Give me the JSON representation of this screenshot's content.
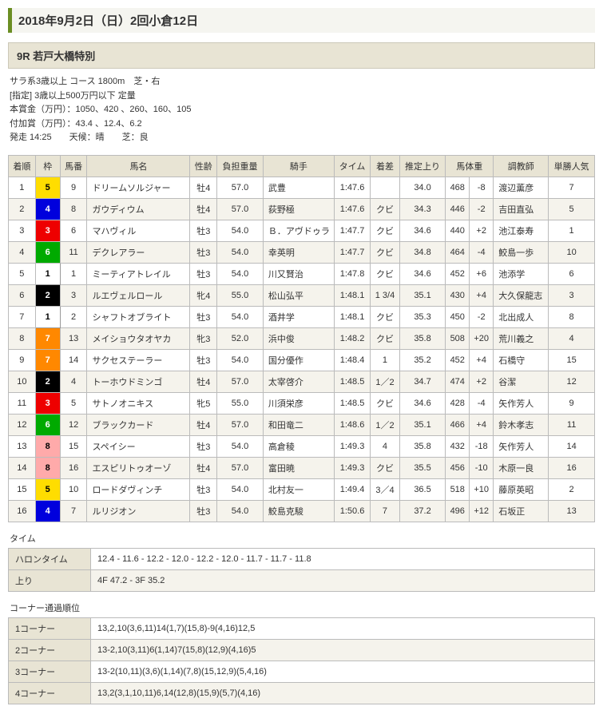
{
  "header": {
    "title": "2018年9月2日（日）2回小倉12日"
  },
  "race": {
    "title": "9R 若戸大橋特別",
    "line1": "サラ系3歳以上 コース 1800m　芝・右",
    "line2": "[指定] 3歳以上500万円以下 定量",
    "line3": "本賞金（万円）：1050、420 、260、160、105",
    "line4": "付加賞（万円）：43.4 、12.4、6.2",
    "line5": "発走 14:25　　天候：晴　　芝：良"
  },
  "columns": {
    "rank": "着順",
    "waku": "枠",
    "num": "馬番",
    "name": "馬名",
    "sex_age": "性齢",
    "weight": "負担重量",
    "jockey": "騎手",
    "time": "タイム",
    "margin": "着差",
    "agari": "推定上り",
    "bweight": "馬体重",
    "trainer": "調教師",
    "pop": "単勝人気"
  },
  "results": [
    {
      "rank": "1",
      "waku": 5,
      "num": "9",
      "name": "ドリームソルジャー",
      "sa": "牡4",
      "w": "57.0",
      "j": "武豊",
      "t": "1:47.6",
      "m": "",
      "a": "34.0",
      "bw": "468",
      "bd": "-8",
      "tr": "渡辺薫彦",
      "p": "7"
    },
    {
      "rank": "2",
      "waku": 4,
      "num": "8",
      "name": "ガウディウム",
      "sa": "牡4",
      "w": "57.0",
      "j": "荻野極",
      "t": "1:47.6",
      "m": "クビ",
      "a": "34.3",
      "bw": "446",
      "bd": "-2",
      "tr": "吉田直弘",
      "p": "5"
    },
    {
      "rank": "3",
      "waku": 3,
      "num": "6",
      "name": "マハヴィル",
      "sa": "牡3",
      "w": "54.0",
      "j": "Ｂ．アヴドゥラ",
      "t": "1:47.7",
      "m": "クビ",
      "a": "34.6",
      "bw": "440",
      "bd": "+2",
      "tr": "池江泰寿",
      "p": "1"
    },
    {
      "rank": "4",
      "waku": 6,
      "num": "11",
      "name": "デクレアラー",
      "sa": "牡3",
      "w": "54.0",
      "j": "幸英明",
      "t": "1:47.7",
      "m": "クビ",
      "a": "34.8",
      "bw": "464",
      "bd": "-4",
      "tr": "鮫島一歩",
      "p": "10"
    },
    {
      "rank": "5",
      "waku": 1,
      "num": "1",
      "name": "ミーティアトレイル",
      "sa": "牡3",
      "w": "54.0",
      "j": "川又賢治",
      "t": "1:47.8",
      "m": "クビ",
      "a": "34.6",
      "bw": "452",
      "bd": "+6",
      "tr": "池添学",
      "p": "6"
    },
    {
      "rank": "6",
      "waku": 2,
      "num": "3",
      "name": "ルエヴェルロール",
      "sa": "牝4",
      "w": "55.0",
      "j": "松山弘平",
      "t": "1:48.1",
      "m": "1 3/4",
      "a": "35.1",
      "bw": "430",
      "bd": "+4",
      "tr": "大久保龍志",
      "p": "3"
    },
    {
      "rank": "7",
      "waku": 1,
      "num": "2",
      "name": "シャフトオブライト",
      "sa": "牡3",
      "w": "54.0",
      "j": "酒井学",
      "t": "1:48.1",
      "m": "クビ",
      "a": "35.3",
      "bw": "450",
      "bd": "-2",
      "tr": "北出成人",
      "p": "8"
    },
    {
      "rank": "8",
      "waku": 7,
      "num": "13",
      "name": "メイショウタオヤカ",
      "sa": "牝3",
      "w": "52.0",
      "j": "浜中俊",
      "t": "1:48.2",
      "m": "クビ",
      "a": "35.8",
      "bw": "508",
      "bd": "+20",
      "tr": "荒川義之",
      "p": "4"
    },
    {
      "rank": "9",
      "waku": 7,
      "num": "14",
      "name": "サクセステーラー",
      "sa": "牡3",
      "w": "54.0",
      "j": "国分優作",
      "t": "1:48.4",
      "m": "1",
      "a": "35.2",
      "bw": "452",
      "bd": "+4",
      "tr": "石橋守",
      "p": "15"
    },
    {
      "rank": "10",
      "waku": 2,
      "num": "4",
      "name": "トーホウドミンゴ",
      "sa": "牡4",
      "w": "57.0",
      "j": "太宰啓介",
      "t": "1:48.5",
      "m": "1／2",
      "a": "34.7",
      "bw": "474",
      "bd": "+2",
      "tr": "谷潔",
      "p": "12"
    },
    {
      "rank": "11",
      "waku": 3,
      "num": "5",
      "name": "サトノオニキス",
      "sa": "牝5",
      "w": "55.0",
      "j": "川須栄彦",
      "t": "1:48.5",
      "m": "クビ",
      "a": "34.6",
      "bw": "428",
      "bd": "-4",
      "tr": "矢作芳人",
      "p": "9"
    },
    {
      "rank": "12",
      "waku": 6,
      "num": "12",
      "name": "ブラックカード",
      "sa": "牡4",
      "w": "57.0",
      "j": "和田竜二",
      "t": "1:48.6",
      "m": "1／2",
      "a": "35.1",
      "bw": "466",
      "bd": "+4",
      "tr": "鈴木孝志",
      "p": "11"
    },
    {
      "rank": "13",
      "waku": 8,
      "num": "15",
      "name": "スペイシー",
      "sa": "牡3",
      "w": "54.0",
      "j": "高倉稜",
      "t": "1:49.3",
      "m": "4",
      "a": "35.8",
      "bw": "432",
      "bd": "-18",
      "tr": "矢作芳人",
      "p": "14"
    },
    {
      "rank": "14",
      "waku": 8,
      "num": "16",
      "name": "エスピリトゥオーゾ",
      "sa": "牡4",
      "w": "57.0",
      "j": "富田暁",
      "t": "1:49.3",
      "m": "クビ",
      "a": "35.5",
      "bw": "456",
      "bd": "-10",
      "tr": "木原一良",
      "p": "16"
    },
    {
      "rank": "15",
      "waku": 5,
      "num": "10",
      "name": "ロードダヴィンチ",
      "sa": "牡3",
      "w": "54.0",
      "j": "北村友一",
      "t": "1:49.4",
      "m": "3／4",
      "a": "36.5",
      "bw": "518",
      "bd": "+10",
      "tr": "藤原英昭",
      "p": "2"
    },
    {
      "rank": "16",
      "waku": 4,
      "num": "7",
      "name": "ルリジオン",
      "sa": "牡3",
      "w": "54.0",
      "j": "鮫島克駿",
      "t": "1:50.6",
      "m": "7",
      "a": "37.2",
      "bw": "496",
      "bd": "+12",
      "tr": "石坂正",
      "p": "13"
    }
  ],
  "time_section": {
    "title": "タイム",
    "halon_label": "ハロンタイム",
    "halon_value": "12.4 - 11.6 - 12.2 - 12.0 - 12.2 - 12.0 - 11.7 - 11.7 - 11.8",
    "agari_label": "上り",
    "agari_value": "4F 47.2 - 3F 35.2"
  },
  "corner_section": {
    "title": "コーナー通過順位",
    "rows": [
      {
        "k": "1コーナー",
        "v": "13,2,10(3,6,11)14(1,7)(15,8)-9(4,16)12,5"
      },
      {
        "k": "2コーナー",
        "v": "13-2,10(3,11)6(1,14)7(15,8)(12,9)(4,16)5"
      },
      {
        "k": "3コーナー",
        "v": "13-2(10,11)(3,6)(1,14)(7,8)(15,12,9)(5,4,16)"
      },
      {
        "k": "4コーナー",
        "v": "13,2(3,1,10,11)6,14(12,8)(15,9)(5,7)(4,16)"
      }
    ]
  }
}
